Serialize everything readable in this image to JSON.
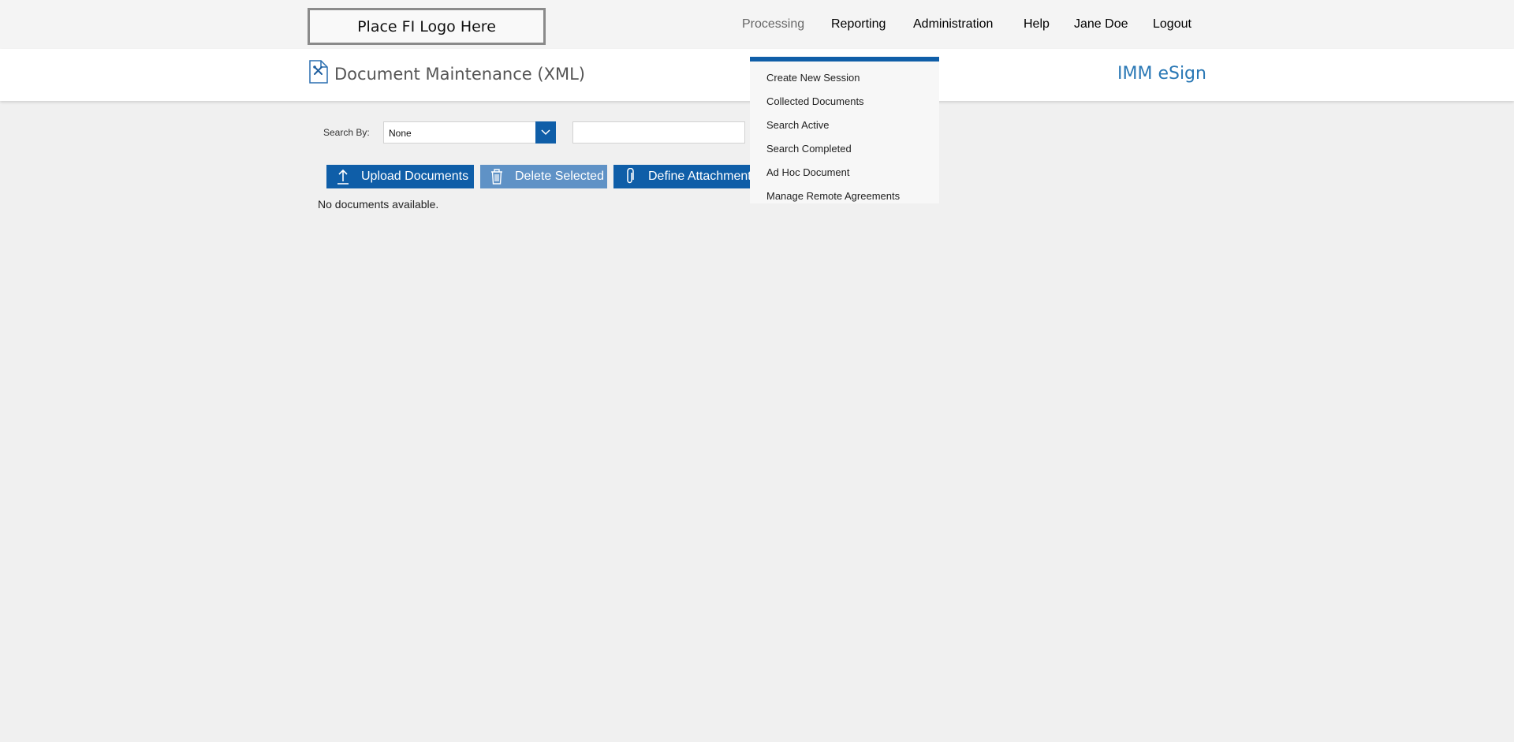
{
  "header": {
    "logo_text": "Place FI Logo Here",
    "nav": [
      "Processing",
      "Reporting",
      "Administration",
      "Help",
      "Jane Doe",
      "Logout"
    ]
  },
  "title_bar": {
    "page_title": "Document Maintenance (XML)",
    "app_name": "IMM eSign"
  },
  "search": {
    "label": "Search By:",
    "selected": "None",
    "input_value": ""
  },
  "toolbar": {
    "upload_label": "Upload Documents",
    "delete_label": "Delete Selected",
    "define_label": "Define Attachment"
  },
  "content": {
    "empty_message": "No documents available."
  },
  "processing_menu": {
    "items": [
      "Create New Session",
      "Collected Documents",
      "Search Active",
      "Search Completed",
      "Ad Hoc Document",
      "Manage Remote Agreements"
    ]
  },
  "colors": {
    "accent": "#0f5ea8",
    "accent_disabled": "#5f92c6",
    "app_name": "#2a78b5",
    "page_bg": "#f0f0f0"
  },
  "icons": {
    "page": "document-tools-icon",
    "select": "chevron-down-icon",
    "upload": "upload-arrow-icon",
    "delete": "trash-icon",
    "define": "paperclip-icon"
  }
}
